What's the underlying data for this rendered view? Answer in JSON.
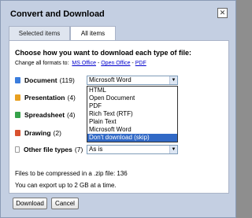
{
  "dialog": {
    "title": "Convert and Download",
    "close_glyph": "✕",
    "tabs": [
      {
        "label": "Selected items",
        "active": false
      },
      {
        "label": "All items",
        "active": true
      }
    ]
  },
  "main": {
    "heading": "Choose how you want to download each type of file:",
    "change_all": {
      "prefix": "Change all formats to:",
      "links": [
        "MS Office",
        "Open Office",
        "PDF"
      ],
      "separator": "-"
    },
    "file_types": [
      {
        "label": "Document",
        "count": "(119)",
        "icon": "document-icon",
        "selected_value": "Microsoft Word"
      },
      {
        "label": "Presentation",
        "count": "(4)",
        "icon": "presentation-icon"
      },
      {
        "label": "Spreadsheet",
        "count": "(4)",
        "icon": "spreadsheet-icon"
      },
      {
        "label": "Drawing",
        "count": "(2)",
        "icon": "drawing-icon"
      },
      {
        "label": "Other file types",
        "count": "(7)",
        "icon": "file-icon",
        "selected_value": "As is"
      }
    ],
    "dropdown": {
      "options": [
        "HTML",
        "Open Document",
        "PDF",
        "Rich Text (RTF)",
        "Plain Text",
        "Microsoft Word",
        "Don't download (skip)"
      ],
      "highlighted_index": 6
    },
    "info": {
      "zip_line": "Files to be compressed in a .zip file: 136",
      "limit_line": "You can export up to 2 GB at a time."
    }
  },
  "footer": {
    "download_label": "Download",
    "cancel_label": "Cancel"
  },
  "colors": {
    "dialog_bg": "#c4cfe2",
    "link": "#0000cc",
    "highlight": "#3169c6"
  }
}
